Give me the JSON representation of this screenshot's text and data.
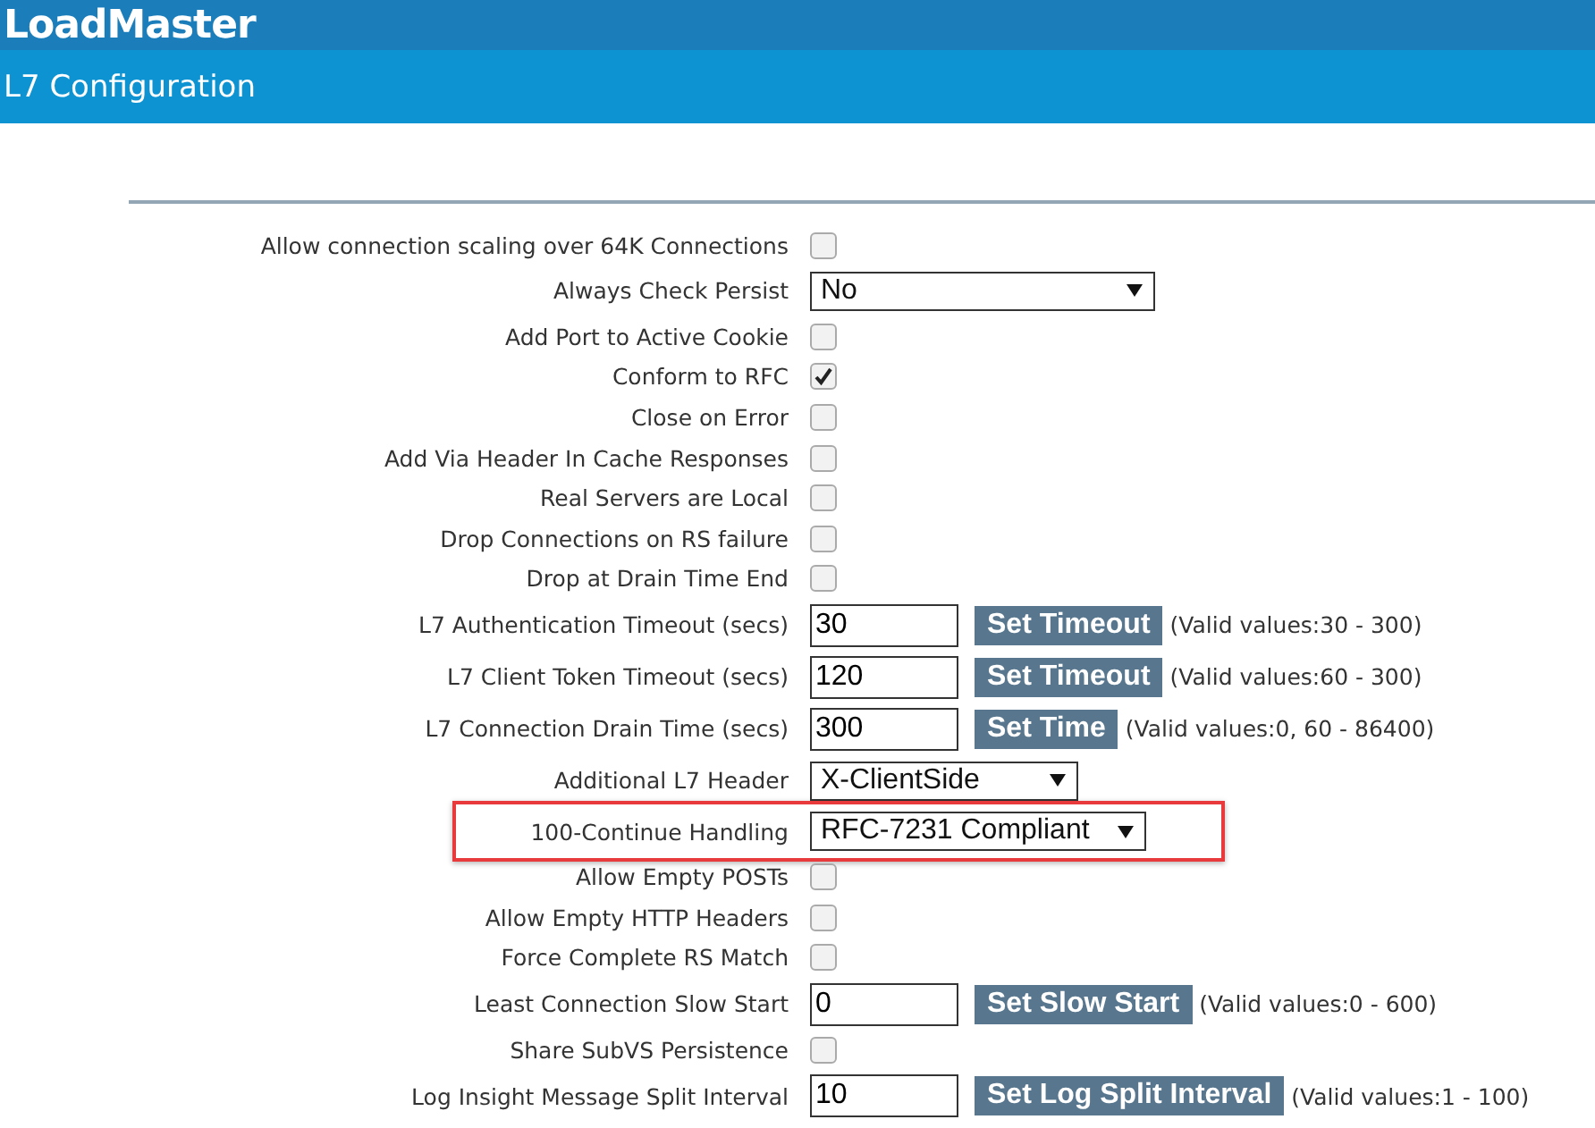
{
  "app": {
    "title": "LoadMaster"
  },
  "page": {
    "title": "L7 Configuration"
  },
  "settings": [
    {
      "kind": "checkbox",
      "label": "Allow connection scaling over 64K Connections",
      "checked": false
    },
    {
      "kind": "select",
      "label": "Always Check Persist",
      "value": "No"
    },
    {
      "kind": "checkbox",
      "label": "Add Port to Active Cookie",
      "checked": false
    },
    {
      "kind": "checkbox",
      "label": "Conform to RFC",
      "checked": true
    },
    {
      "kind": "checkbox",
      "label": "Close on Error",
      "checked": false
    },
    {
      "kind": "checkbox",
      "label": "Add Via Header In Cache Responses",
      "checked": false
    },
    {
      "kind": "checkbox",
      "label": "Real Servers are Local",
      "checked": false
    },
    {
      "kind": "checkbox",
      "label": "Drop Connections on RS failure",
      "checked": false
    },
    {
      "kind": "checkbox",
      "label": "Drop at Drain Time End",
      "checked": false
    },
    {
      "kind": "input",
      "label": "L7 Authentication Timeout (secs)",
      "value": "30",
      "button": "Set Timeout",
      "hint": "(Valid values:30 - 300)"
    },
    {
      "kind": "input",
      "label": "L7 Client Token Timeout (secs)",
      "value": "120",
      "button": "Set Timeout",
      "hint": "(Valid values:60 - 300)"
    },
    {
      "kind": "input",
      "label": "L7 Connection Drain Time (secs)",
      "value": "300",
      "button": "Set Time",
      "hint": "(Valid values:0, 60 - 86400)"
    },
    {
      "kind": "select",
      "label": "Additional L7 Header",
      "value": "X-ClientSide"
    },
    {
      "kind": "select",
      "label": "100-Continue Handling",
      "value": "RFC-7231 Compliant",
      "highlighted": true
    },
    {
      "kind": "checkbox",
      "label": "Allow Empty POSTs",
      "checked": false
    },
    {
      "kind": "checkbox",
      "label": "Allow Empty HTTP Headers",
      "checked": false
    },
    {
      "kind": "checkbox",
      "label": "Force Complete RS Match",
      "checked": false
    },
    {
      "kind": "input",
      "label": "Least Connection Slow Start",
      "value": "0",
      "button": "Set Slow Start",
      "hint": "(Valid values:0 - 600)"
    },
    {
      "kind": "checkbox",
      "label": "Share SubVS Persistence",
      "checked": false
    },
    {
      "kind": "input",
      "label": "Log Insight Message Split Interval",
      "value": "10",
      "button": "Set Log Split Interval",
      "hint": "(Valid values:1 - 100)"
    }
  ]
}
